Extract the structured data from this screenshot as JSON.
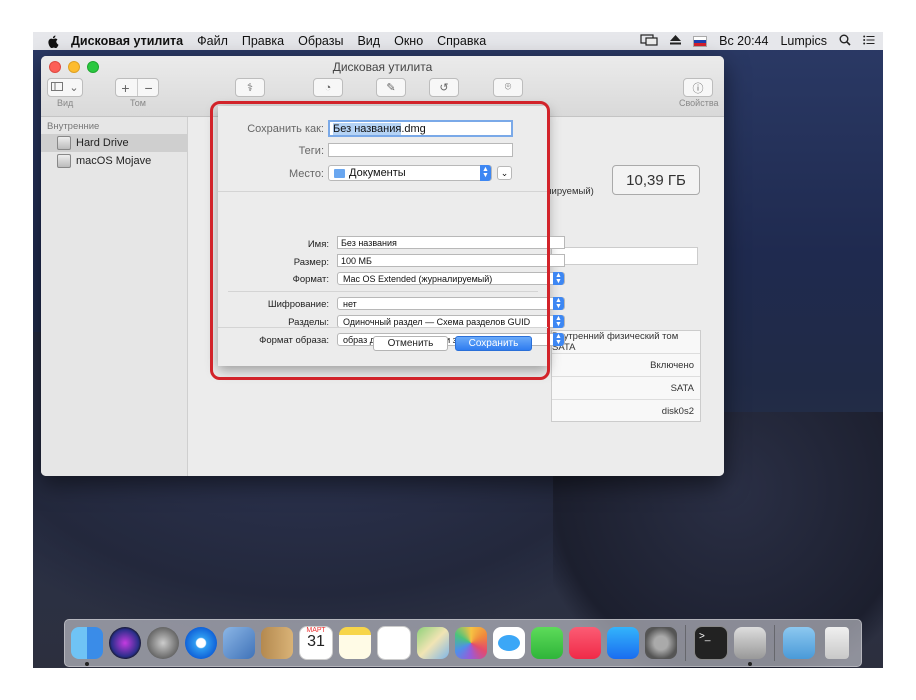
{
  "menubar": {
    "app": "Дисковая утилита",
    "items": [
      "Файл",
      "Правка",
      "Образы",
      "Вид",
      "Окно",
      "Справка"
    ],
    "clock": "Вс 20:44",
    "user": "Lumpics"
  },
  "window": {
    "title": "Дисковая утилита",
    "toolbar": {
      "view_label": "Вид",
      "volume_label": "Том",
      "info_label": "Свойства"
    },
    "sidebar": {
      "section": "Внутренние",
      "items": [
        "Hard Drive",
        "macOS Mojave"
      ]
    },
    "capacity": "10,39 ГБ",
    "partial_text": "лируемый)",
    "info_rows": [
      "Внутренний физический том SATA",
      "Включено",
      "SATA",
      "disk0s2"
    ]
  },
  "dialog": {
    "save_as_label": "Сохранить как:",
    "save_as_selected": "Без названия",
    "save_as_ext": ".dmg",
    "tags_label": "Теги:",
    "tags_value": "",
    "where_label": "Место:",
    "where_value": "Документы",
    "name_label": "Имя:",
    "name_value": "Без названия",
    "size_label": "Размер:",
    "size_value": "100 МБ",
    "format_label": "Формат:",
    "format_value": "Mac OS Extended (журналируемый)",
    "encryption_label": "Шифрование:",
    "encryption_value": "нет",
    "partitions_label": "Разделы:",
    "partitions_value": "Одиночный раздел — Схема разделов GUID",
    "image_format_label": "Формат образа:",
    "image_format_value": "образ диска для чтения и записи",
    "cancel": "Отменить",
    "save": "Сохранить"
  },
  "calendar": {
    "month": "МАРТ",
    "day": "31"
  },
  "colors": {
    "accent": "#3d87f3",
    "highlight_outline": "#d2232a"
  },
  "dock": [
    "finder-icon",
    "siri-icon",
    "launchpad-icon",
    "safari-icon",
    "mail-icon",
    "contacts-icon",
    "calendar-icon",
    "notes-icon",
    "reminders-icon",
    "maps-icon",
    "photos-icon",
    "messages-icon",
    "facetime-icon",
    "music-icon",
    "app-store-icon",
    "system-preferences-icon",
    "terminal-icon",
    "disk-utility-icon",
    "downloads-icon",
    "trash-icon"
  ]
}
